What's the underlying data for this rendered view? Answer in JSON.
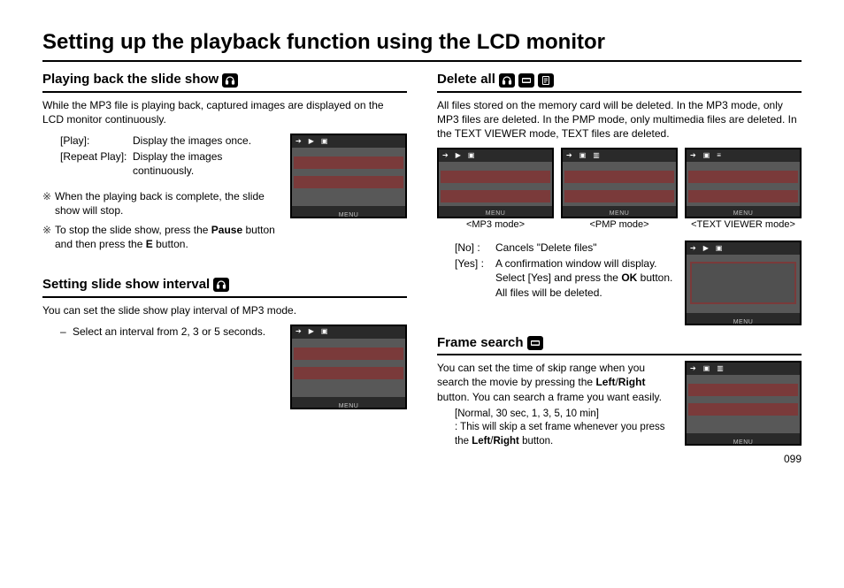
{
  "page_title": "Setting up the playback function using the LCD monitor",
  "page_number": "099",
  "lcd_menu_label": "MENU",
  "left": {
    "sec1": {
      "heading": "Playing back the slide show",
      "intro": "While the MP3 file is playing back, captured images are displayed on the LCD monitor continuously.",
      "opts": {
        "play_key": "[Play]:",
        "play_val": "Display the images once.",
        "repeat_key": "[Repeat Play]:",
        "repeat_val": "Display the images continuously."
      },
      "bullets": [
        "When the playing back is complete, the slide show will stop.",
        "To stop the slide show, press the Pause button and then press the E button."
      ]
    },
    "sec2": {
      "heading": "Setting slide show interval",
      "intro": "You can set the slide show play interval of MP3 mode.",
      "note_prefix": "–",
      "note": "Select an interval from 2, 3 or 5 seconds."
    }
  },
  "right": {
    "sec1": {
      "heading": "Delete all",
      "intro": "All files stored on the memory card will be deleted. In the MP3 mode, only MP3 files are deleted. In the PMP mode, only multimedia files are deleted. In the TEXT VIEWER mode, TEXT files are deleted.",
      "captions": [
        "<MP3 mode>",
        "<PMP mode>",
        "<TEXT VIEWER mode>"
      ],
      "opts": {
        "no_key": "[No] :",
        "no_val": "Cancels \"Delete files\"",
        "yes_key": "[Yes] :",
        "yes_val": "A confirmation window will display. Select [Yes] and press the OK button. All files will be deleted."
      }
    },
    "sec2": {
      "heading": "Frame search",
      "intro": "You can set the time of skip range when you search the movie by pressing the Left/Right button. You can search a frame you want easily.",
      "range": "[Normal, 30 sec, 1, 3, 5, 10 min]",
      "range_desc": ": This will skip a set frame whenever you press the Left/Right button."
    }
  }
}
